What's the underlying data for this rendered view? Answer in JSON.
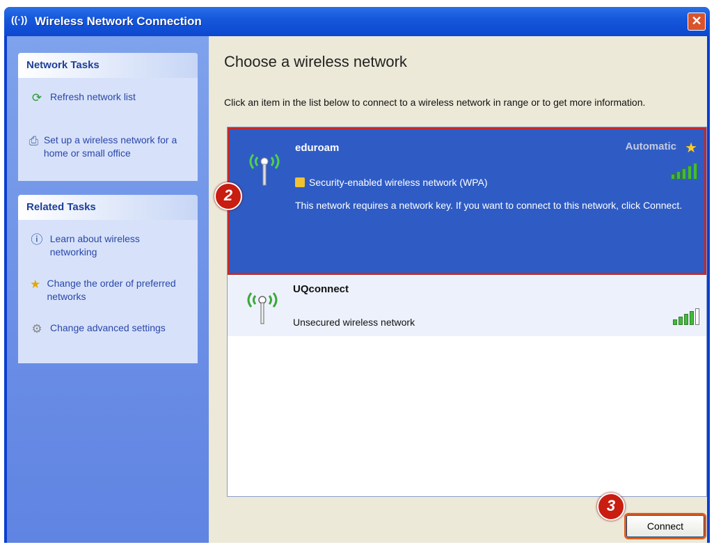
{
  "window": {
    "title": "Wireless Network Connection",
    "close_glyph": "✕"
  },
  "sidebar": {
    "network_tasks": {
      "title": "Network Tasks",
      "items": [
        {
          "label": "Refresh network list",
          "icon": "refresh-icon"
        },
        {
          "label": "Set up a wireless network for a home or small office",
          "icon": "setup-wizard-icon"
        }
      ]
    },
    "related_tasks": {
      "title": "Related Tasks",
      "items": [
        {
          "label": "Learn about wireless networking",
          "icon": "info-icon"
        },
        {
          "label": "Change the order of preferred networks",
          "icon": "star-icon"
        },
        {
          "label": "Change advanced settings",
          "icon": "settings-icon"
        }
      ]
    }
  },
  "main": {
    "heading": "Choose a wireless network",
    "description": "Click an item in the list below to connect to a wireless network in range or to get more information.",
    "networks": [
      {
        "ssid": "eduroam",
        "status": "Automatic",
        "security": "Security-enabled wireless network (WPA)",
        "message": "This network requires a network key. If you want to connect to this network, click Connect.",
        "signal_bars": 5,
        "selected": true
      },
      {
        "ssid": "UQconnect",
        "security": "Unsecured wireless network",
        "signal_bars": 4,
        "selected": false
      }
    ],
    "connect_label": "Connect"
  },
  "annotations": {
    "step2": "2",
    "step3": "3"
  },
  "colors": {
    "selection_blue": "#2f5cc4",
    "highlight_red": "#c22a2a",
    "badge_red": "#c81d10",
    "sidebar_blue": "#6a8ee6"
  }
}
